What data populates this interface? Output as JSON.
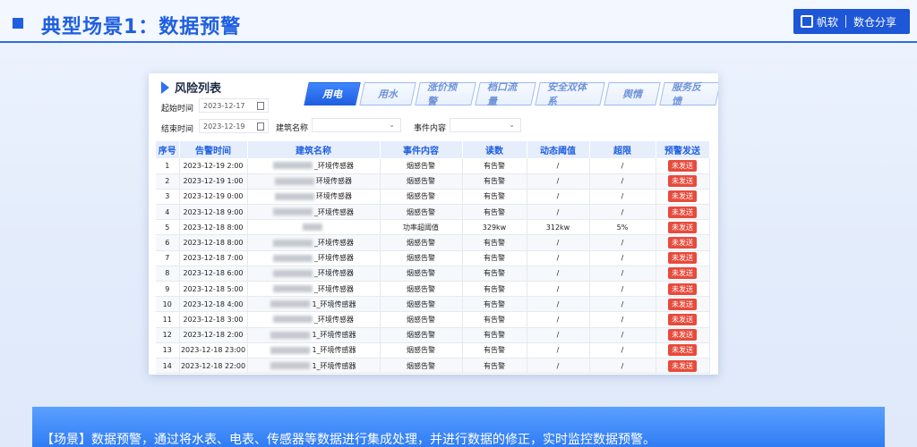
{
  "header": {
    "title": "典型场景1：数据预警",
    "brand_name": "帆软",
    "brand_subtitle": "数仓分享"
  },
  "panel": {
    "title": "风险列表",
    "filters": {
      "start_label": "起始时间",
      "start_value": "2023-12-17",
      "end_label": "结束时间",
      "end_value": "2023-12-19",
      "building_label": "建筑名称",
      "event_label": "事件内容"
    },
    "tabs": [
      "用电",
      "用水",
      "涨价预警",
      "档口流量",
      "安全双体系",
      "舆情",
      "服务反馈"
    ],
    "active_tab": "用电",
    "columns": [
      "序号",
      "告警时间",
      "建筑名称",
      "事件内容",
      "读数",
      "动态阈值",
      "超限",
      "预警发送"
    ],
    "rows": [
      {
        "no": "1",
        "time": "2023-12-19 2:00",
        "name": "_环境传感器",
        "event": "烟感告警",
        "reading": "有告警",
        "threshold": "/",
        "over": "/",
        "status": "未发送"
      },
      {
        "no": "2",
        "time": "2023-12-19 1:00",
        "name": "环境传感器",
        "event": "烟感告警",
        "reading": "有告警",
        "threshold": "/",
        "over": "/",
        "status": "未发送"
      },
      {
        "no": "3",
        "time": "2023-12-19 0:00",
        "name": "环境传感器",
        "event": "烟感告警",
        "reading": "有告警",
        "threshold": "/",
        "over": "/",
        "status": "未发送"
      },
      {
        "no": "4",
        "time": "2023-12-18 9:00",
        "name": "_环境传感器",
        "event": "烟感告警",
        "reading": "有告警",
        "threshold": "/",
        "over": "/",
        "status": "未发送"
      },
      {
        "no": "5",
        "time": "2023-12-18 8:00",
        "name": "",
        "event": "功率超阈值",
        "reading": "329kw",
        "threshold": "312kw",
        "over": "5%",
        "status": "未发送"
      },
      {
        "no": "6",
        "time": "2023-12-18 8:00",
        "name": "_环境传感器",
        "event": "烟感告警",
        "reading": "有告警",
        "threshold": "/",
        "over": "/",
        "status": "未发送"
      },
      {
        "no": "7",
        "time": "2023-12-18 7:00",
        "name": "_环境传感器",
        "event": "烟感告警",
        "reading": "有告警",
        "threshold": "/",
        "over": "/",
        "status": "未发送"
      },
      {
        "no": "8",
        "time": "2023-12-18 6:00",
        "name": "_环境传感器",
        "event": "烟感告警",
        "reading": "有告警",
        "threshold": "/",
        "over": "/",
        "status": "未发送"
      },
      {
        "no": "9",
        "time": "2023-12-18 5:00",
        "name": "_环境传感器",
        "event": "烟感告警",
        "reading": "有告警",
        "threshold": "/",
        "over": "/",
        "status": "未发送"
      },
      {
        "no": "10",
        "time": "2023-12-18 4:00",
        "name": "1_环境传感器",
        "event": "烟感告警",
        "reading": "有告警",
        "threshold": "/",
        "over": "/",
        "status": "未发送"
      },
      {
        "no": "11",
        "time": "2023-12-18 3:00",
        "name": "_环境传感器",
        "event": "烟感告警",
        "reading": "有告警",
        "threshold": "/",
        "over": "/",
        "status": "未发送"
      },
      {
        "no": "12",
        "time": "2023-12-18 2:00",
        "name": "1_环境传感器",
        "event": "烟感告警",
        "reading": "有告警",
        "threshold": "/",
        "over": "/",
        "status": "未发送"
      },
      {
        "no": "13",
        "time": "2023-12-18 23:00",
        "name": "1_环境传感器",
        "event": "烟感告警",
        "reading": "有告警",
        "threshold": "/",
        "over": "/",
        "status": "未发送"
      },
      {
        "no": "14",
        "time": "2023-12-18 22:00",
        "name": "1_环境传感器",
        "event": "烟感告警",
        "reading": "有告警",
        "threshold": "/",
        "over": "/",
        "status": "未发送"
      }
    ]
  },
  "footer": {
    "text": "【场景】数据预警，通过将水表、电表、传感器等数据进行集成处理，并进行数据的修正，实时监控数据预警。"
  },
  "colors": {
    "accent": "#1f5fe0",
    "alert": "#e74b3c"
  }
}
